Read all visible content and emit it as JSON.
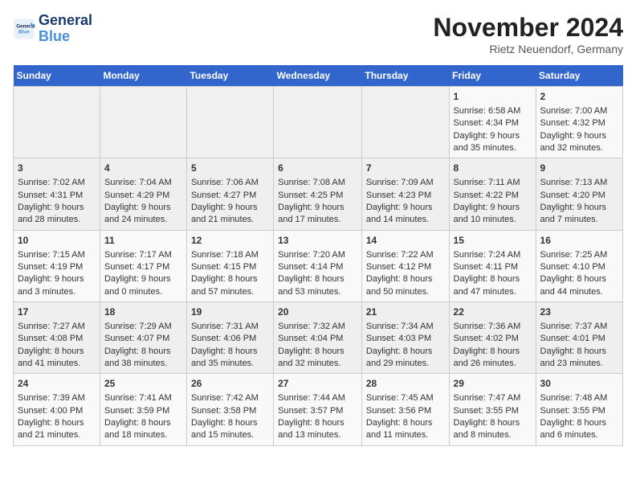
{
  "header": {
    "logo_line1": "General",
    "logo_line2": "Blue",
    "month_title": "November 2024",
    "location": "Rietz Neuendorf, Germany"
  },
  "weekdays": [
    "Sunday",
    "Monday",
    "Tuesday",
    "Wednesday",
    "Thursday",
    "Friday",
    "Saturday"
  ],
  "weeks": [
    [
      {
        "day": "",
        "info": ""
      },
      {
        "day": "",
        "info": ""
      },
      {
        "day": "",
        "info": ""
      },
      {
        "day": "",
        "info": ""
      },
      {
        "day": "",
        "info": ""
      },
      {
        "day": "1",
        "info": "Sunrise: 6:58 AM\nSunset: 4:34 PM\nDaylight: 9 hours and 35 minutes."
      },
      {
        "day": "2",
        "info": "Sunrise: 7:00 AM\nSunset: 4:32 PM\nDaylight: 9 hours and 32 minutes."
      }
    ],
    [
      {
        "day": "3",
        "info": "Sunrise: 7:02 AM\nSunset: 4:31 PM\nDaylight: 9 hours and 28 minutes."
      },
      {
        "day": "4",
        "info": "Sunrise: 7:04 AM\nSunset: 4:29 PM\nDaylight: 9 hours and 24 minutes."
      },
      {
        "day": "5",
        "info": "Sunrise: 7:06 AM\nSunset: 4:27 PM\nDaylight: 9 hours and 21 minutes."
      },
      {
        "day": "6",
        "info": "Sunrise: 7:08 AM\nSunset: 4:25 PM\nDaylight: 9 hours and 17 minutes."
      },
      {
        "day": "7",
        "info": "Sunrise: 7:09 AM\nSunset: 4:23 PM\nDaylight: 9 hours and 14 minutes."
      },
      {
        "day": "8",
        "info": "Sunrise: 7:11 AM\nSunset: 4:22 PM\nDaylight: 9 hours and 10 minutes."
      },
      {
        "day": "9",
        "info": "Sunrise: 7:13 AM\nSunset: 4:20 PM\nDaylight: 9 hours and 7 minutes."
      }
    ],
    [
      {
        "day": "10",
        "info": "Sunrise: 7:15 AM\nSunset: 4:19 PM\nDaylight: 9 hours and 3 minutes."
      },
      {
        "day": "11",
        "info": "Sunrise: 7:17 AM\nSunset: 4:17 PM\nDaylight: 9 hours and 0 minutes."
      },
      {
        "day": "12",
        "info": "Sunrise: 7:18 AM\nSunset: 4:15 PM\nDaylight: 8 hours and 57 minutes."
      },
      {
        "day": "13",
        "info": "Sunrise: 7:20 AM\nSunset: 4:14 PM\nDaylight: 8 hours and 53 minutes."
      },
      {
        "day": "14",
        "info": "Sunrise: 7:22 AM\nSunset: 4:12 PM\nDaylight: 8 hours and 50 minutes."
      },
      {
        "day": "15",
        "info": "Sunrise: 7:24 AM\nSunset: 4:11 PM\nDaylight: 8 hours and 47 minutes."
      },
      {
        "day": "16",
        "info": "Sunrise: 7:25 AM\nSunset: 4:10 PM\nDaylight: 8 hours and 44 minutes."
      }
    ],
    [
      {
        "day": "17",
        "info": "Sunrise: 7:27 AM\nSunset: 4:08 PM\nDaylight: 8 hours and 41 minutes."
      },
      {
        "day": "18",
        "info": "Sunrise: 7:29 AM\nSunset: 4:07 PM\nDaylight: 8 hours and 38 minutes."
      },
      {
        "day": "19",
        "info": "Sunrise: 7:31 AM\nSunset: 4:06 PM\nDaylight: 8 hours and 35 minutes."
      },
      {
        "day": "20",
        "info": "Sunrise: 7:32 AM\nSunset: 4:04 PM\nDaylight: 8 hours and 32 minutes."
      },
      {
        "day": "21",
        "info": "Sunrise: 7:34 AM\nSunset: 4:03 PM\nDaylight: 8 hours and 29 minutes."
      },
      {
        "day": "22",
        "info": "Sunrise: 7:36 AM\nSunset: 4:02 PM\nDaylight: 8 hours and 26 minutes."
      },
      {
        "day": "23",
        "info": "Sunrise: 7:37 AM\nSunset: 4:01 PM\nDaylight: 8 hours and 23 minutes."
      }
    ],
    [
      {
        "day": "24",
        "info": "Sunrise: 7:39 AM\nSunset: 4:00 PM\nDaylight: 8 hours and 21 minutes."
      },
      {
        "day": "25",
        "info": "Sunrise: 7:41 AM\nSunset: 3:59 PM\nDaylight: 8 hours and 18 minutes."
      },
      {
        "day": "26",
        "info": "Sunrise: 7:42 AM\nSunset: 3:58 PM\nDaylight: 8 hours and 15 minutes."
      },
      {
        "day": "27",
        "info": "Sunrise: 7:44 AM\nSunset: 3:57 PM\nDaylight: 8 hours and 13 minutes."
      },
      {
        "day": "28",
        "info": "Sunrise: 7:45 AM\nSunset: 3:56 PM\nDaylight: 8 hours and 11 minutes."
      },
      {
        "day": "29",
        "info": "Sunrise: 7:47 AM\nSunset: 3:55 PM\nDaylight: 8 hours and 8 minutes."
      },
      {
        "day": "30",
        "info": "Sunrise: 7:48 AM\nSunset: 3:55 PM\nDaylight: 8 hours and 6 minutes."
      }
    ]
  ]
}
